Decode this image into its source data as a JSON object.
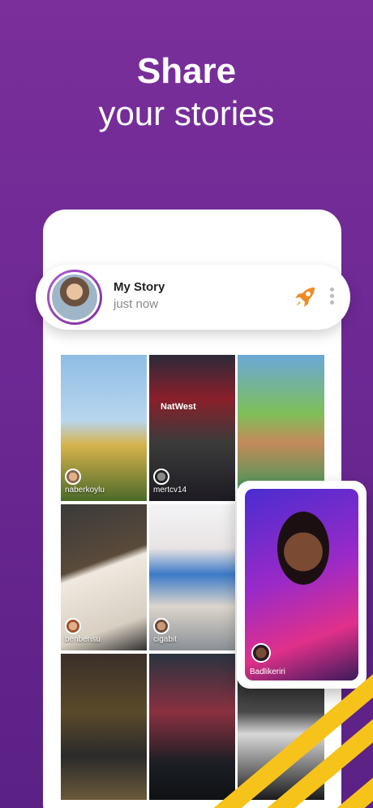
{
  "headline": {
    "line1": "Share",
    "line2": "your stories"
  },
  "my_story": {
    "title": "My Story",
    "time": "just now",
    "action_icon": "rocket-icon",
    "menu_icon": "more-vertical-icon"
  },
  "tiles": [
    {
      "user": "naberkoylu"
    },
    {
      "user": "mertcv14",
      "sign": "NatWest"
    },
    {
      "user": ""
    },
    {
      "user": "benbensu"
    },
    {
      "user": "cigabit"
    },
    {
      "user": ""
    },
    {
      "user": ""
    },
    {
      "user": ""
    }
  ],
  "featured": {
    "user": "Badlikeriri"
  },
  "colors": {
    "background": "#7a2f9a",
    "accent": "#f6c31b",
    "rocket": "#f08a24"
  }
}
